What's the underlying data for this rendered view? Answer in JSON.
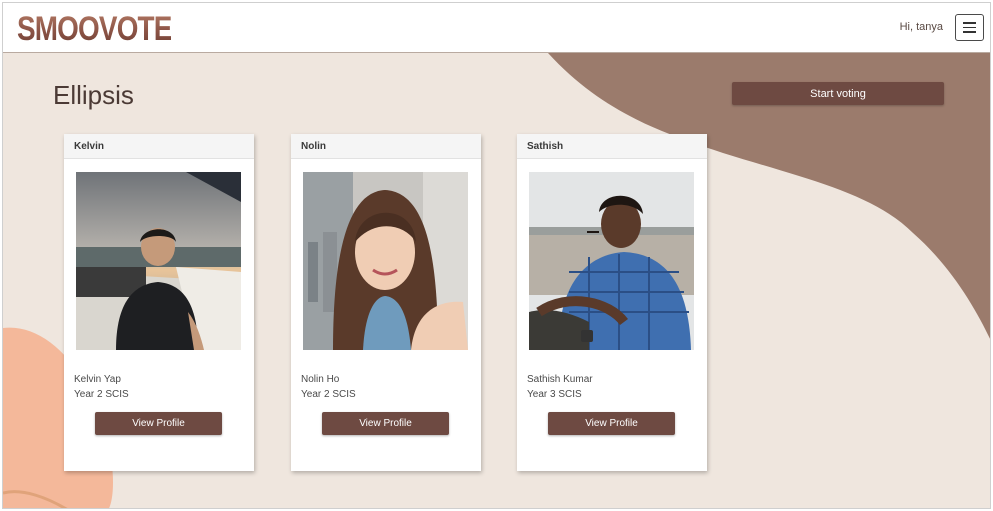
{
  "header": {
    "logo_text": "SMOOVOTE",
    "greeting": "Hi, tanya",
    "menu_icon": "hamburger-icon"
  },
  "main": {
    "title": "Ellipsis",
    "start_button_label": "Start voting"
  },
  "candidates": [
    {
      "header": "Kelvin",
      "name": "Kelvin Yap",
      "year": "Year 2 SCIS",
      "button_label": "View Profile"
    },
    {
      "header": "Nolin",
      "name": "Nolin Ho",
      "year": "Year 2 SCIS",
      "button_label": "View Profile"
    },
    {
      "header": "Sathish",
      "name": "Sathish Kumar",
      "year": "Year 3 SCIS",
      "button_label": "View Profile"
    }
  ],
  "colors": {
    "accent": "#6e4a42",
    "background": "#efe6de",
    "wave": "#9b7b6c",
    "blob": "#f4b89a"
  }
}
